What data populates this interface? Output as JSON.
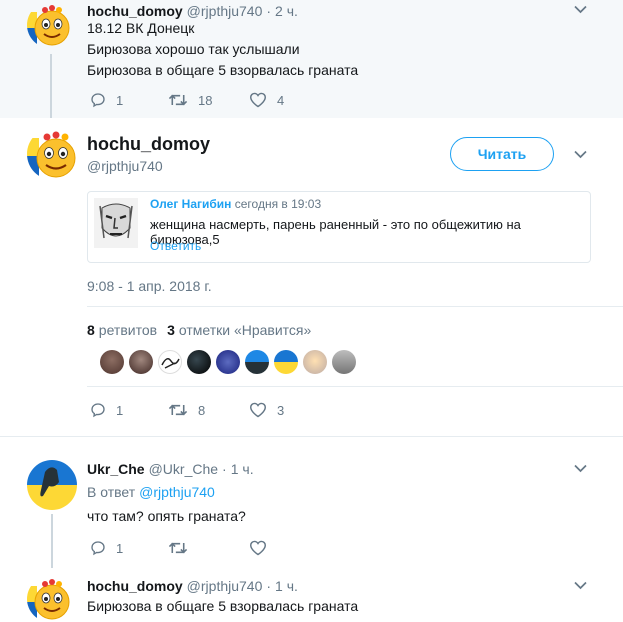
{
  "parent_tweet": {
    "display_name": "hochu_domoy",
    "handle": "@rjpthju740",
    "time": "2 ч.",
    "lines": [
      "18.12 ВК Донецк",
      "Бирюзова хорошо так услышали",
      "Бирюзова в общаге 5 взорвалась граната"
    ],
    "replies": "1",
    "retweets": "18",
    "likes": "4"
  },
  "main_tweet": {
    "display_name": "hochu_domoy",
    "handle": "@rjpthju740",
    "follow_label": "Читать",
    "quote": {
      "author": "Олег Нагибин",
      "time": "сегодня в 19:03",
      "text": "женщина насмерть, парень раненный - это по общежитию на бирюзова,5",
      "reply_link": "Ответить"
    },
    "timestamp": "9:08 - 1 апр. 2018 г.",
    "retweets_count": "8",
    "retweets_label": "ретвитов",
    "likes_count": "3",
    "likes_label": "отметки «Нравится»",
    "replies": "1",
    "retweets": "8",
    "likes": "3"
  },
  "reply_tweet": {
    "display_name": "Ukr_Che",
    "handle": "@Ukr_Che",
    "time": "1 ч.",
    "reply_to_prefix": "В ответ",
    "reply_to_handle": "@rjpthju740",
    "text": "что там? опять граната?",
    "replies": "1"
  },
  "last_tweet": {
    "display_name": "hochu_domoy",
    "handle": "@rjpthju740",
    "time": "1 ч.",
    "text": "Бирюзова в общаге 5 взорвалась граната"
  },
  "separator": "·",
  "colors": {
    "accent": "#1da1f2",
    "muted": "#657786",
    "parent_bg": "#f5f8fa"
  },
  "icons": [
    "reply-icon",
    "retweet-icon",
    "heart-icon",
    "chevron-down-icon"
  ]
}
